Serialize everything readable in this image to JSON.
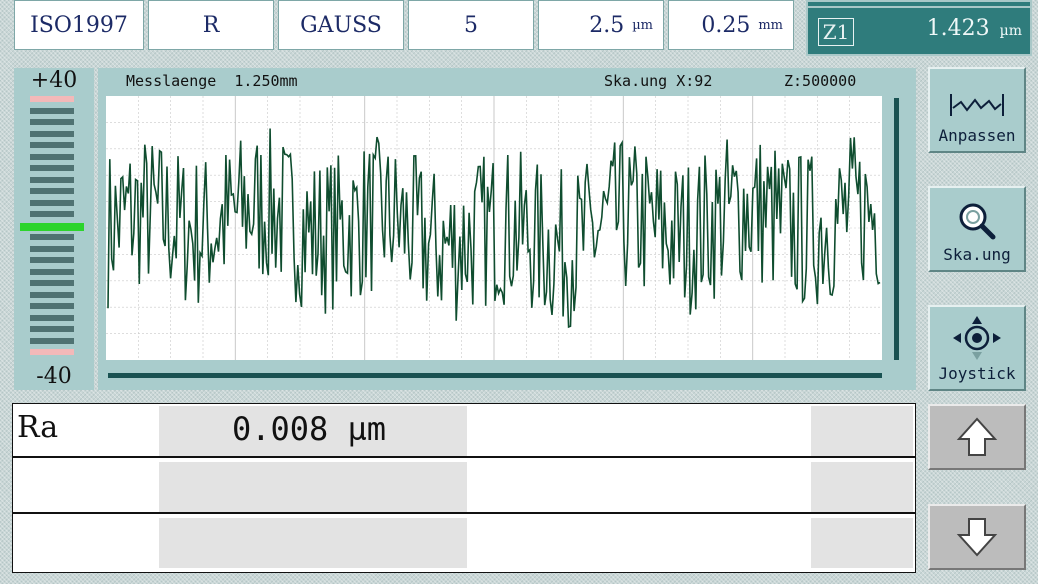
{
  "header": {
    "standard": "ISO1997",
    "profile": "R",
    "filter": "GAUSS",
    "n_cutoff": "5",
    "lambda_s": {
      "value": "2.5",
      "unit": "µm"
    },
    "lambda_c": {
      "value": "0.25",
      "unit": "mm"
    }
  },
  "z_display": {
    "label": "Z1",
    "value": "1.423",
    "unit": "µm"
  },
  "scale": {
    "top": "+40",
    "bottom": "-40"
  },
  "chart": {
    "length_label": "Messlaenge",
    "length_value": "1.250mm",
    "scaling_label": "Ska.ung",
    "x_scale": "X:92",
    "z_scale": "Z:500000",
    "trace_color": "#0f4d2f",
    "grid_color": "#c9c9c9"
  },
  "chart_data": {
    "type": "line",
    "title": "",
    "xlabel": "",
    "ylabel": "",
    "grid": true,
    "seed": 7,
    "points": 420,
    "ylim": [
      -1,
      1
    ]
  },
  "side_buttons": [
    {
      "label": "Anpassen",
      "icon": "fit-profile-icon"
    },
    {
      "label": "Ska.ung",
      "icon": "magnifier-icon"
    },
    {
      "label": "Joystick",
      "icon": "joystick-icon"
    }
  ],
  "results": [
    {
      "label": "Ra",
      "value": "0.008 µm"
    },
    {
      "label": "",
      "value": ""
    },
    {
      "label": "",
      "value": ""
    }
  ]
}
